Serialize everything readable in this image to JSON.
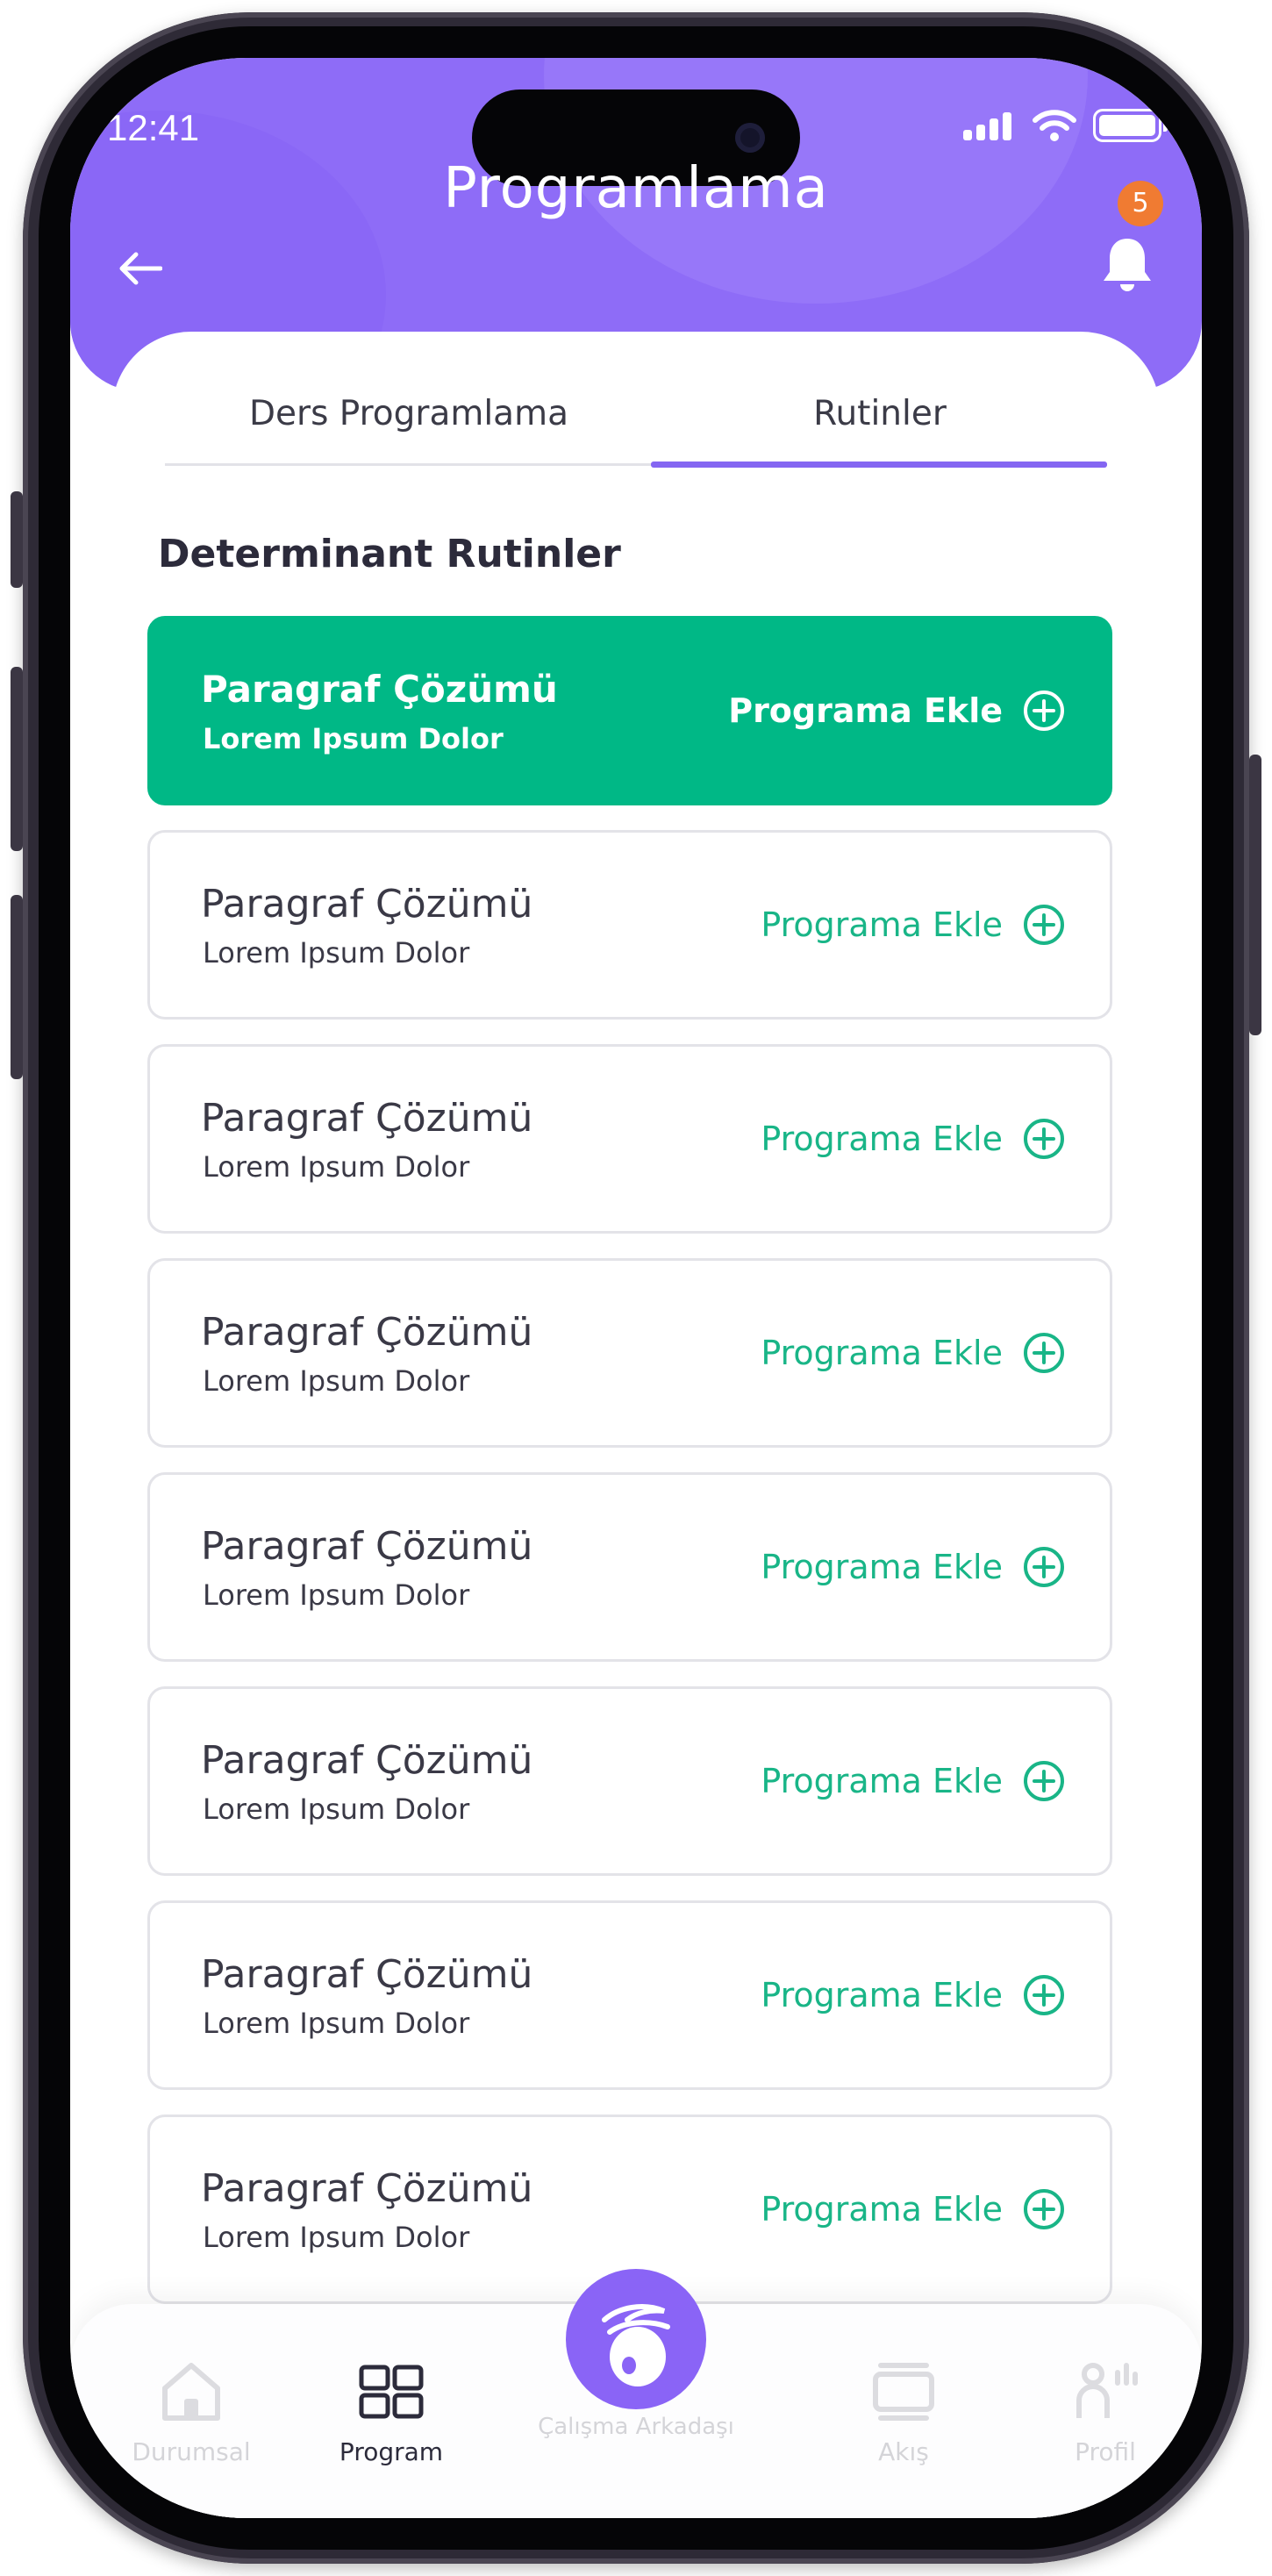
{
  "status_bar": {
    "time": "12:41"
  },
  "header": {
    "title": "Programlama",
    "notification_count": "5"
  },
  "tabs": [
    {
      "label": "Ders Programlama",
      "active": false
    },
    {
      "label": "Rutinler",
      "active": true
    }
  ],
  "section": {
    "title": "Determinant Rutinler"
  },
  "routines": [
    {
      "title": "Paragraf Çözümü",
      "subtitle": "Lorem Ipsum Dolor",
      "action": "Programa Ekle",
      "active": true
    },
    {
      "title": "Paragraf Çözümü",
      "subtitle": "Lorem Ipsum Dolor",
      "action": "Programa Ekle",
      "active": false
    },
    {
      "title": "Paragraf Çözümü",
      "subtitle": "Lorem Ipsum Dolor",
      "action": "Programa Ekle",
      "active": false
    },
    {
      "title": "Paragraf Çözümü",
      "subtitle": "Lorem Ipsum Dolor",
      "action": "Programa Ekle",
      "active": false
    },
    {
      "title": "Paragraf Çözümü",
      "subtitle": "Lorem Ipsum Dolor",
      "action": "Programa Ekle",
      "active": false
    },
    {
      "title": "Paragraf Çözümü",
      "subtitle": "Lorem Ipsum Dolor",
      "action": "Programa Ekle",
      "active": false
    },
    {
      "title": "Paragraf Çözümü",
      "subtitle": "Lorem Ipsum Dolor",
      "action": "Programa Ekle",
      "active": false
    },
    {
      "title": "Paragraf Çözümü",
      "subtitle": "Lorem Ipsum Dolor",
      "action": "Programa Ekle",
      "active": false
    }
  ],
  "bottom_nav": [
    {
      "label": "Durumsal",
      "icon": "home-icon",
      "active": false
    },
    {
      "label": "Program",
      "icon": "grid-icon",
      "active": true
    },
    {
      "label": "Çalışma Arkadaşı",
      "icon": "bunny-icon",
      "active": false
    },
    {
      "label": "Akış",
      "icon": "feed-icon",
      "active": false
    },
    {
      "label": "Profil",
      "icon": "profile-icon",
      "active": false
    }
  ],
  "colors": {
    "primary_purple": "#8e6cf7",
    "accent_green": "#00b886",
    "badge_orange": "#f07b32"
  }
}
